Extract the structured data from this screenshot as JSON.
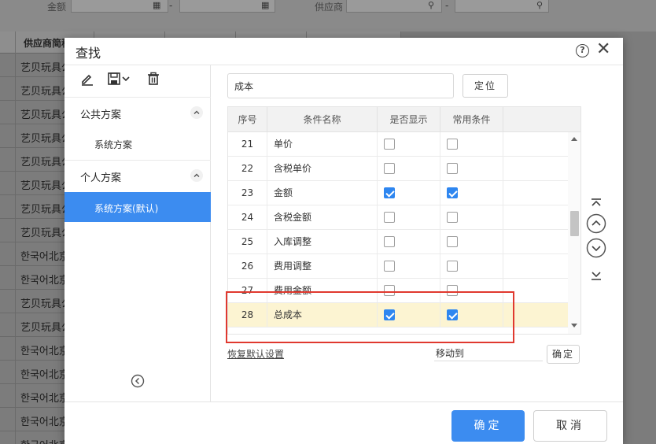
{
  "background": {
    "filter_labels": [
      "金额",
      "供应商"
    ],
    "table_header": "供应商简称",
    "rows": [
      "艺贝玩具公",
      "艺贝玩具公",
      "艺贝玩具公",
      "艺贝玩具公",
      "艺贝玩具公",
      "艺贝玩具公",
      "艺贝玩具公",
      "艺贝玩具公",
      "한국어北京",
      "한국어北京",
      "艺贝玩具公",
      "艺贝玩具公",
      "한국어北京",
      "한국어北京",
      "한국어北京",
      "한국어北京",
      "한국어北京"
    ]
  },
  "dialog": {
    "title": "查找",
    "help_label": "?",
    "close_label": "✕"
  },
  "left_panel": {
    "public_section": {
      "title": "公共方案",
      "items": [
        "系统方案"
      ]
    },
    "personal_section": {
      "title": "个人方案",
      "items": [
        "系统方案(默认)"
      ]
    }
  },
  "search": {
    "value": "成本",
    "locate_button": "定位"
  },
  "grid": {
    "columns": [
      "序号",
      "条件名称",
      "是否显示",
      "常用条件"
    ],
    "rows": [
      {
        "no": "21",
        "name": "单价",
        "show": false,
        "common": false
      },
      {
        "no": "22",
        "name": "含税单价",
        "show": false,
        "common": false
      },
      {
        "no": "23",
        "name": "金额",
        "show": true,
        "common": true
      },
      {
        "no": "24",
        "name": "含税金额",
        "show": false,
        "common": false
      },
      {
        "no": "25",
        "name": "入库调整",
        "show": false,
        "common": false
      },
      {
        "no": "26",
        "name": "费用调整",
        "show": false,
        "common": false
      },
      {
        "no": "27",
        "name": "费用金额",
        "show": false,
        "common": false
      },
      {
        "no": "28",
        "name": "总成本",
        "show": true,
        "common": true,
        "highlighted": true
      }
    ]
  },
  "bottom": {
    "restore_link": "恢复默认设置",
    "moveto_value": "移动到",
    "small_ok": "确定"
  },
  "footer": {
    "confirm": "确定",
    "cancel": "取消"
  },
  "colors": {
    "primary": "#3c8cf0",
    "highlight_row": "#fcf4d2",
    "annotation": "#e0392f"
  }
}
